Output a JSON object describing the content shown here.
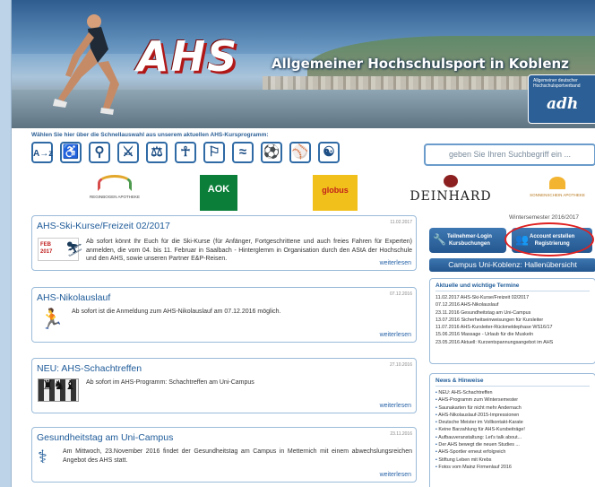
{
  "header": {
    "logo": "AHS",
    "tagline": "Allgemeiner Hochschulsport in Koblenz",
    "adh_small": "Allgemeiner deutscher Hochschulsportverband",
    "adh_logo": "adh"
  },
  "quick": {
    "label": "Wählen Sie hier über die Schnellauswahl aus unserem aktuellen AHS-Kursprogramm:",
    "icons": [
      "az-icon",
      "cycling-icon",
      "gymnastics-icon",
      "martial-arts-icon",
      "fitness-icon",
      "dance-icon",
      "running-icon",
      "swimming-icon",
      "team-sports-icon",
      "racket-sports-icon",
      "yoga-icon"
    ],
    "first_icon_text": "A→z"
  },
  "search": {
    "placeholder": "geben Sie Ihren Suchbegriff ein ..."
  },
  "sponsors": {
    "apotheke1": "REGINBOGEN APOTHEKE",
    "aok": "AOK",
    "globus": "globus",
    "deinhard": "DEINHARD",
    "sonnenschein": "SONNENSCHEIN APOTHEKE"
  },
  "news": [
    {
      "title": "AHS-Ski-Kurse/Freizeit 02/2017",
      "date": "11.02.2017",
      "badge": "FEB 2017",
      "text": "Ab sofort könnt Ihr Euch für die Ski-Kurse (für Anfänger, Fortgeschrittene und auch freies Fahren für Experten) anmelden, die vom 04. bis 11. Februar in Saalbach - Hinterglemm in Organisation durch den AStA der Hochschule und den AHS, sowie unseren Partner E&P-Reisen.",
      "more": "weiterlesen"
    },
    {
      "title": "AHS-Nikolauslauf",
      "date": "07.12.2016",
      "text": "Ab sofort ist die Anmeldung zum AHS-Nikolauslauf am 07.12.2016 möglich.",
      "more": "weiterlesen"
    },
    {
      "title": "NEU: AHS-Schachtreffen",
      "date": "27.10.2016",
      "text": "Ab sofort im AHS-Programm: Schachtreffen am Uni-Campus",
      "more": "weiterlesen"
    },
    {
      "title": "Gesundheitstag am Uni-Campus",
      "date": "23.11.2016",
      "text": "Am Mittwoch, 23.November 2016 findet der Gesundheitstag am Campus in Metternich mit einem abwechslungsreichen Angebot des AHS statt.",
      "more": "weiterlesen"
    }
  ],
  "sidebar": {
    "season": "Wintersemester 2016/2017",
    "login_btn": "Teilnehmer-Login\nKursbuchungen",
    "account_btn": "Account erstellen\nRegistrierung",
    "campus": "Campus Uni-Koblenz: Hallenübersicht",
    "termine_title": "Aktuelle und wichtige Termine",
    "termine": [
      "11.02.2017 AHS-Ski-Kurse/Freizeit 02/2017",
      "07.12.2016 AHS-Nikolauslauf",
      "23.11.2016 Gesundheitstag am Uni-Campus",
      "13.07.2016 Sicherheitseinweisungen für Kursleiter",
      "11.07.2016 AHS-Kursleiter-Rückmeldephase WS16/17",
      "15.06.2016 Massage - Urlaub für die Muskeln",
      "23.05.2016 Aktuell: Kurzentspannungsangebot im AHS"
    ],
    "hinweise_title": "News & Hinweise",
    "hinweise": [
      "NEU: AHS-Schachtreffen",
      "AHS-Programm zum Wintersemester",
      "Saunakarten für nicht mehr Andernach",
      "AHS-Nikolauslauf-2015-Impressionen",
      "Deutsche Meister im Vollkontakt-Karate",
      "Keine Barzahlung für AHS-Kursbeiträge!",
      "Aufbauveranstaltung: Let's talk about...",
      "Der AHS bewegt die neuen Studies ...",
      "AHS-Sportler erneut erfolgreich",
      "Stiftung Leben mit Krebs",
      "Fotos vom Mainz Firmenlauf 2016"
    ]
  }
}
